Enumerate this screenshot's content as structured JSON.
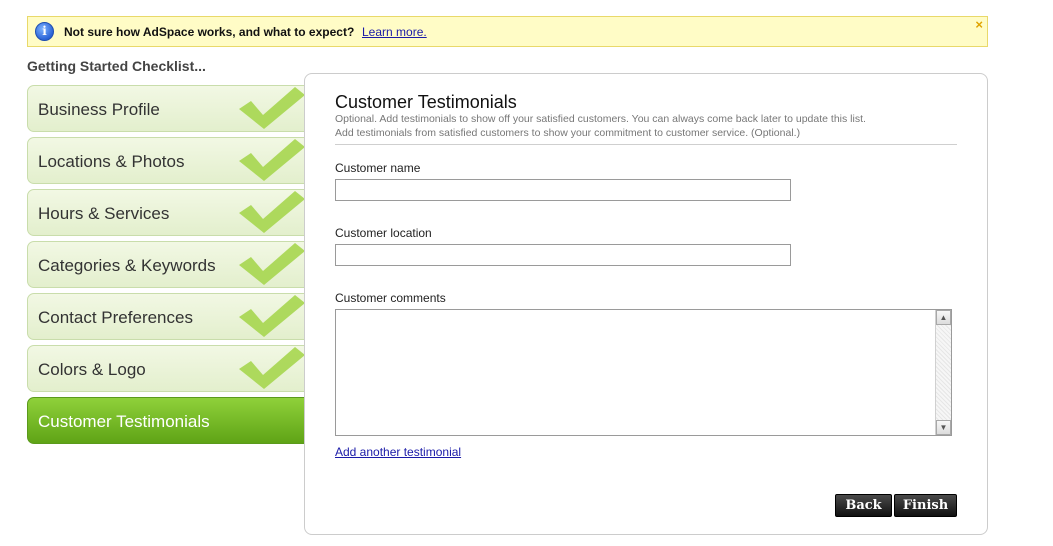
{
  "banner": {
    "message": "Not sure how AdSpace works, and what to expect?",
    "link": "Learn more.",
    "close": "×",
    "info_icon": "i"
  },
  "checklist": {
    "title": "Getting Started Checklist...",
    "steps": [
      {
        "label": "Business Profile",
        "completed": true
      },
      {
        "label": "Locations & Photos",
        "completed": true
      },
      {
        "label": "Hours & Services",
        "completed": true
      },
      {
        "label": "Categories & Keywords",
        "completed": true
      },
      {
        "label": "Contact Preferences",
        "completed": true
      },
      {
        "label": "Colors & Logo",
        "completed": true
      },
      {
        "label": "Customer Testimonials",
        "completed": false,
        "active": true
      }
    ]
  },
  "form": {
    "title": "Customer Testimonials",
    "description_line1": "Optional. Add testimonials to show off your satisfied customers. You can always come back later to update this list.",
    "description_line2": "Add testimonials from satisfied customers to show your commitment to customer service. (Optional.)",
    "name_label": "Customer name",
    "name_value": "",
    "location_label": "Customer location",
    "location_value": "",
    "comments_label": "Customer comments",
    "comments_value": "",
    "add_link": "Add another testimonial",
    "back_button": "Back",
    "finish_button": "Finish"
  },
  "colors": {
    "check_green": "#a6d64f",
    "active_step_green": "#6cb21e",
    "banner_bg": "#fffcc6"
  }
}
